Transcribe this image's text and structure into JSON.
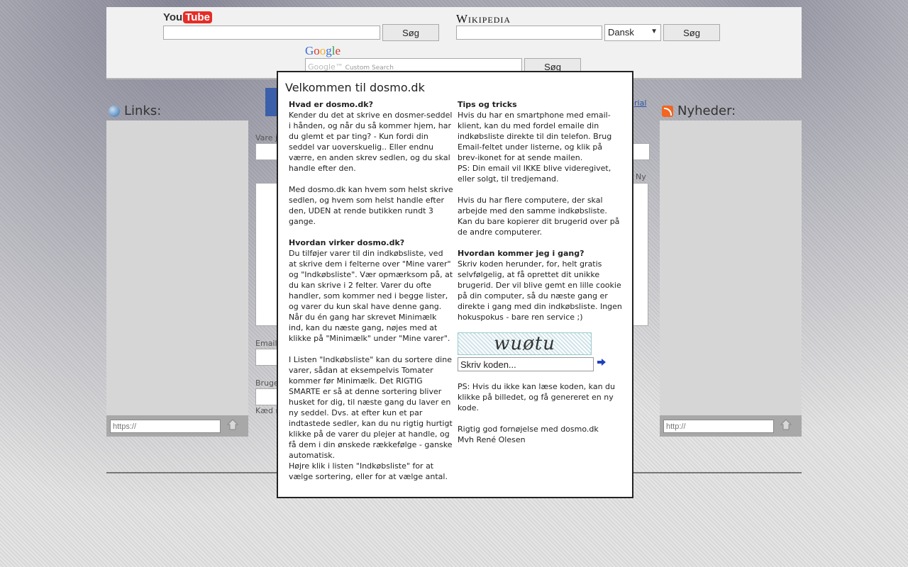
{
  "youtube": {
    "logo_you": "You",
    "logo_tube": "Tube",
    "input_value": "",
    "button": "Søg"
  },
  "wikipedia": {
    "logo": "Wikipedia",
    "input_value": "",
    "language": "Dansk",
    "button": "Søg"
  },
  "google": {
    "logo": [
      "G",
      "o",
      "o",
      "g",
      "l",
      "e"
    ],
    "placeholder_brand": "Google™",
    "placeholder_text": "Custom Search",
    "button": "Søg"
  },
  "links": {
    "title": "Links:",
    "url_placeholder": "https://"
  },
  "news": {
    "title": "Nyheder:",
    "url_placeholder": "http://"
  },
  "center": {
    "items_label": "Vare j",
    "tutorial_link": "rial",
    "new_label": "Ny",
    "email_label": "Email:",
    "user_label": "Bruge",
    "kaed_label": "Kæd n"
  },
  "modal": {
    "title": "Velkommen til dosmo.dk",
    "left": {
      "h1": "Hvad er dosmo.dk?",
      "p1": "Kender du det at skrive en dosmer-seddel i hånden, og når du så kommer hjem, har du glemt et par ting? - Kun fordi din seddel var uoverskuelig.. Eller endnu værre, en anden skrev sedlen, og du skal handle efter den.",
      "p2": "Med dosmo.dk kan hvem som helst skrive sedlen, og hvem som helst handle efter den, UDEN at rende butikken rundt 3 gange.",
      "h2": "Hvordan virker dosmo.dk?",
      "p3": "Du tilføjer varer til din indkøbsliste, ved at skrive dem i felterne over \"Mine varer\" og \"Indkøbsliste\". Vær opmærksom på, at du kan skrive i 2 felter. Varer du ofte handler, som kommer ned i begge lister, og varer du kun skal have denne gang. Når du én gang har skrevet Minimælk ind, kan du næste gang, nøjes med at klikke på \"Minimælk\" under \"Mine varer\".",
      "p4": "I Listen \"Indkøbsliste\" kan du sortere dine varer, sådan at eksempelvis Tomater kommer før Minimælk. Det RIGTIG SMARTE er så at denne sortering bliver husket for dig, til næste gang du laver en ny seddel. Dvs. at efter kun et par indtastede sedler, kan du nu rigtig hurtigt klikke på de varer du plejer at handle, og få dem i din ønskede rækkefølge - ganske automatisk.",
      "p5": "Højre klik i listen \"Indkøbsliste\" for at vælge sortering, eller for at vælge antal."
    },
    "right": {
      "h1": "Tips og tricks",
      "p1": "Hvis du har en smartphone med email-klient, kan du med fordel emaile din indkøbsliste direkte til din telefon. Brug Email-feltet under listerne, og klik på brev-ikonet for at sende mailen.",
      "p1b": "PS: Din email vil IKKE blive videregivet, eller solgt, til tredjemand.",
      "p2": "Hvis du har flere computere, der skal arbejde med den samme indkøbsliste. Kan du bare kopierer dit brugerid over på de andre computerer.",
      "h2": "Hvordan kommer jeg i gang?",
      "p3": "Skriv koden herunder, for, helt gratis selvfølgelig, at få oprettet dit unikke brugerid. Der vil blive gemt en lille cookie på din computer, så du næste gang er direkte i gang med din indkøbsliste. Ingen hokuspokus - bare ren service ;)",
      "captcha_text": "wuøtu",
      "code_value": "Skriv koden...",
      "p4": "PS: Hvis du ikke kan læse koden, kan du klikke på billedet, og få genereret en ny kode.",
      "p5": "Rigtig god fornøjelse med dosmo.dk",
      "p6": "Mvh René Olesen"
    }
  },
  "colors": {
    "overlay_border": "#222222",
    "youtube_red": "#e52d27",
    "rss_orange": "#f26522"
  }
}
